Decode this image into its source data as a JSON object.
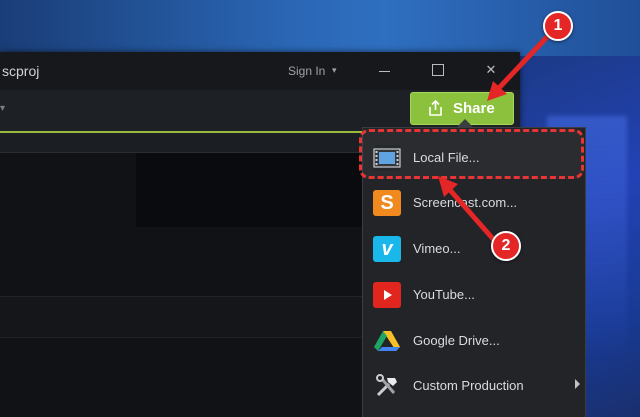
{
  "window": {
    "title": "scproj",
    "sign_in_label": "Sign In",
    "sign_in_caret": "▾",
    "close_glyph": "✕"
  },
  "toolbar": {
    "left_caret": "▾",
    "share_label": "Share"
  },
  "share_menu": {
    "items": [
      {
        "label": "Local File...",
        "icon": "film-icon"
      },
      {
        "label": "Screencast.com...",
        "icon": "screencast-icon",
        "icon_glyph": "S"
      },
      {
        "label": "Vimeo...",
        "icon": "vimeo-icon",
        "icon_glyph": "v"
      },
      {
        "label": "YouTube...",
        "icon": "youtube-icon"
      },
      {
        "label": "Google Drive...",
        "icon": "google-drive-icon"
      },
      {
        "label": "Custom Production",
        "icon": "tools-icon",
        "has_submenu": true
      }
    ]
  },
  "annotations": {
    "step1": "1",
    "step2": "2",
    "color": "#e52626"
  },
  "colors": {
    "share_green": "#8bc13c",
    "accent_line": "#9ab83a",
    "desktop_blue": "#2a66b4"
  }
}
